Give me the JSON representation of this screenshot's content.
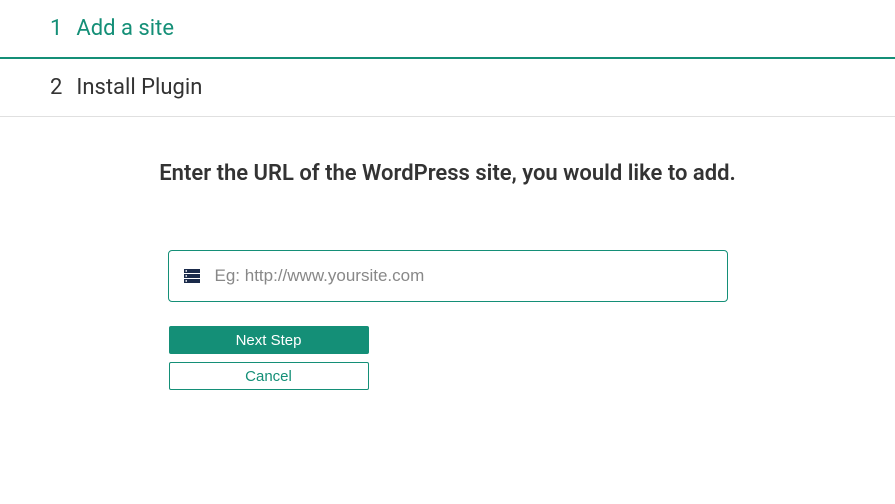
{
  "steps": {
    "step1": {
      "number": "1",
      "label": "Add a site"
    },
    "step2": {
      "number": "2",
      "label": "Install Plugin"
    }
  },
  "content": {
    "instruction": "Enter the URL of the WordPress site, you would like to add.",
    "url_placeholder": "Eg: http://www.yoursite.com",
    "url_value": ""
  },
  "buttons": {
    "next_label": "Next Step",
    "cancel_label": "Cancel"
  },
  "colors": {
    "accent": "#148f77"
  }
}
